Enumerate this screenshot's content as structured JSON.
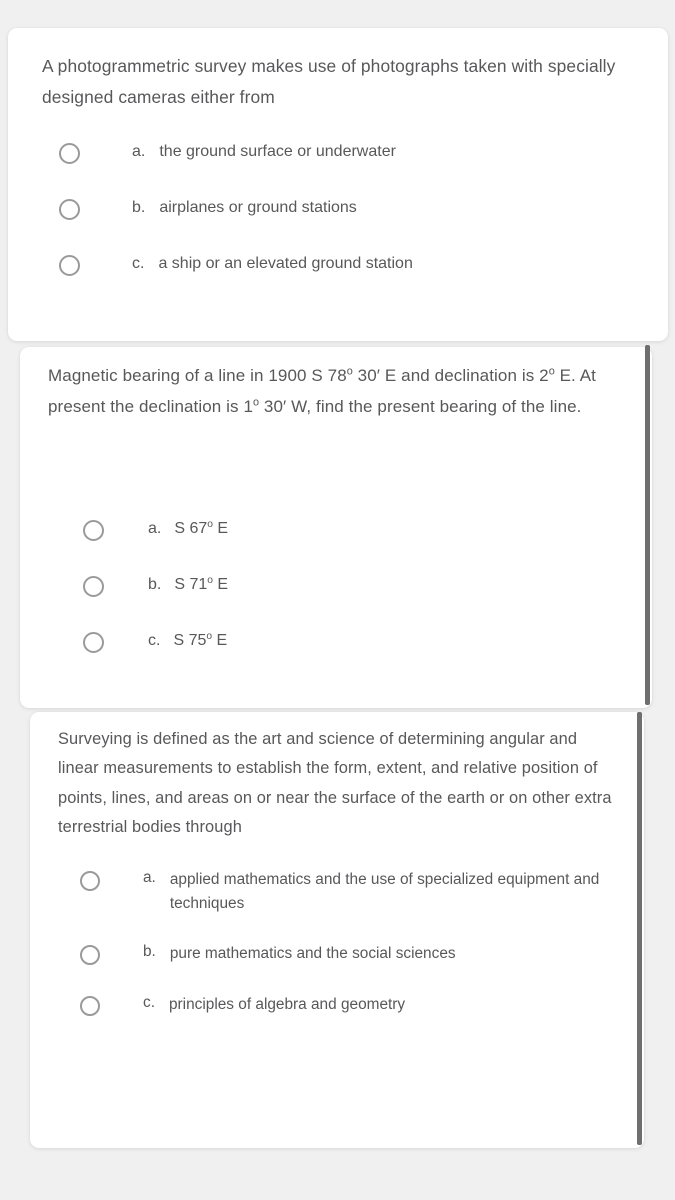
{
  "background_color": "#f0f0f0",
  "card_color": "#ffffff",
  "text_color": "#58585a",
  "scrollbar_color": "#6f6f6f",
  "cards": [
    {
      "id": "card-1",
      "question": "A photogrammetric survey makes use of photographs taken with specially designed cameras either from",
      "options": [
        {
          "letter": "a.",
          "text": "the ground surface or underwater"
        },
        {
          "letter": "b.",
          "text": "airplanes or ground stations"
        },
        {
          "letter": "c.",
          "text": "a ship or an elevated ground station"
        }
      ]
    },
    {
      "id": "card-2",
      "question_parts": [
        {
          "text": "Magnetic bearing of a line in 1900 S 78"
        },
        {
          "deg": "o"
        },
        {
          "text": " 30′ E and declination is 2"
        },
        {
          "deg": "o"
        },
        {
          "text": " E. At present the declination is 1"
        },
        {
          "deg": "o"
        },
        {
          "text": " 30′ W, find the present bearing of the line."
        }
      ],
      "question_plain": "Magnetic bearing of a line in 1900 S 78o 30' E and declination is 2o E. At present the declination is 1o 30' W, find the present bearing of the line.",
      "options": [
        {
          "letter": "a.",
          "parts": [
            {
              "text": "S 67"
            },
            {
              "deg": "o"
            },
            {
              "text": " E"
            }
          ],
          "plain": "S 67o E"
        },
        {
          "letter": "b.",
          "parts": [
            {
              "text": "S 71"
            },
            {
              "deg": "o"
            },
            {
              "text": " E"
            }
          ],
          "plain": "S 71o E"
        },
        {
          "letter": "c.",
          "parts": [
            {
              "text": "S 75"
            },
            {
              "deg": "o"
            },
            {
              "text": " E"
            }
          ],
          "plain": "S 75o E"
        }
      ]
    },
    {
      "id": "card-3",
      "question": "Surveying is defined as the art and science of determining angular and linear measurements to establish the form, extent, and relative position of points, lines, and areas on or near the surface of the earth or  on other extra terrestrial bodies through",
      "options": [
        {
          "letter": "a.",
          "text": "applied mathematics and the use of specialized equipment and techniques"
        },
        {
          "letter": "b.",
          "text": "pure mathematics and the social sciences"
        },
        {
          "letter": "c.",
          "text": "principles of algebra and geometry"
        }
      ]
    }
  ]
}
